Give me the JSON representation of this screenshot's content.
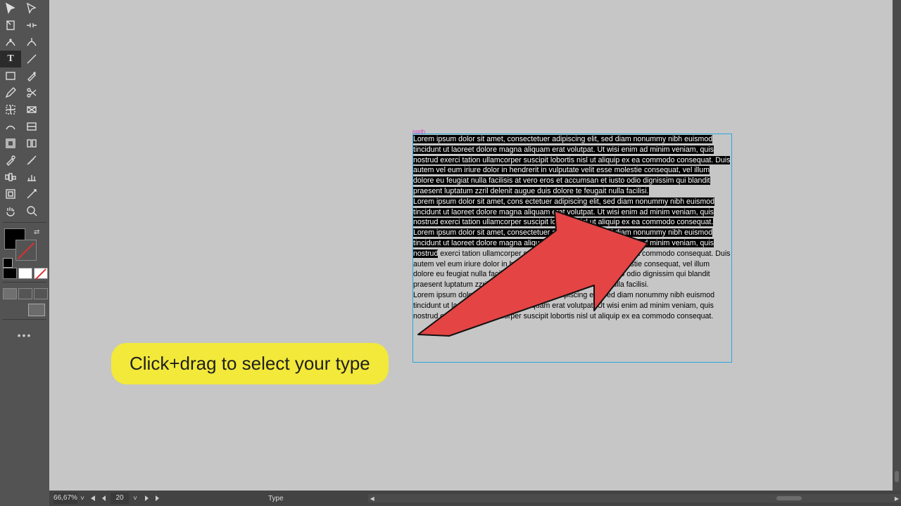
{
  "meta": {
    "domain": "Computer-Use",
    "app_guess": "Adobe InDesign",
    "viewport": "1280x720"
  },
  "toolbox": {
    "tools": [
      "selection-tool",
      "direct-selection-tool",
      "page-tool",
      "gap-tool",
      "content-collector-tool",
      "content-placer-tool",
      "type-tool",
      "line-tool",
      "rectangle-frame-tool",
      "pen-tool",
      "pencil-tool",
      "scissors-tool",
      "free-transform-tool",
      "rectangle-tool",
      "gradient-swatch-tool",
      "gradient-feather-tool",
      "note-tool",
      "color-theme-tool",
      "eyedropper-tool",
      "measure-tool",
      "smooth-tool",
      "chart-tool",
      "erase-tool",
      "hand-tool-alt",
      "hand-tool",
      "zoom-tool"
    ],
    "selected": "type-tool",
    "colors": {
      "fill": "#000000",
      "stroke": "none"
    }
  },
  "canvas": {
    "text_frame": {
      "in_port_label": "north",
      "paragraphs": [
        {
          "sel": true,
          "t": "Lorem ipsum dolor sit amet, consectetuer adipiscing elit, sed diam nonummy nibh euismod tincidunt ut laoreet dolore magna aliquam erat volutpat. Ut wisi enim ad minim veniam, quis nostrud exerci tation ullamcorper suscipit lobortis nisl ut aliquip ex ea commodo consequat. Duis autem vel eum iriure dolor in hendrerit in vulputate velit esse molestie consequat, vel illum dolore eu feugiat nulla facilisis at vero eros et accumsan et iusto odio dignissim qui blandit praesent luptatum zzril delenit augue duis dolore te feugait nulla facilisi."
        },
        {
          "sel": true,
          "t": "Lorem ipsum dolor sit amet, cons ectetuer adipiscing elit, sed diam nonummy nibh euismod tincidunt ut laoreet dolore magna aliquam erat volutpat. Ut wisi enim ad minim veniam, quis nostrud exerci tation ullamcorper suscipit lobortis nisl ut aliquip ex ea commodo consequat."
        },
        {
          "sel": "partial",
          "break_after_words": 29,
          "t": "Lorem ipsum dolor sit amet, consectetuer adipiscing elit, sed diam nonummy nibh euismod tincidunt ut laoreet dolore magna aliquam erat volutpat. Ut wisi enim ad minim veniam, quis nostrud exerci tation ullamcorper suscipit lobortis nisl ut aliquip ex ea commodo consequat. Duis autem vel eum iriure dolor in hendrerit in vulputate velit esse molestie consequat, vel illum dolore eu feugiat nulla facilisis at vero eros et accumsan et iusto odio dignissim qui blandit praesent luptatum zzril delenit augue duis dolore te feugait nulla facilisi."
        },
        {
          "sel": false,
          "t": "Lorem ipsum dolor sit amet, cons ectetuer adipiscing elit, sed diam nonummy nibh euismod tincidunt ut laoreet dolore magna aliquam erat volutpat. Ut wisi enim ad minim veniam, quis nostrud exerci tation ullamcorper suscipit lobortis nisl ut aliquip ex ea commodo consequat."
        }
      ]
    },
    "callout": "Click+drag to select your type"
  },
  "statusbar": {
    "zoom": "66,67%",
    "page": "20",
    "mode": "Type"
  }
}
